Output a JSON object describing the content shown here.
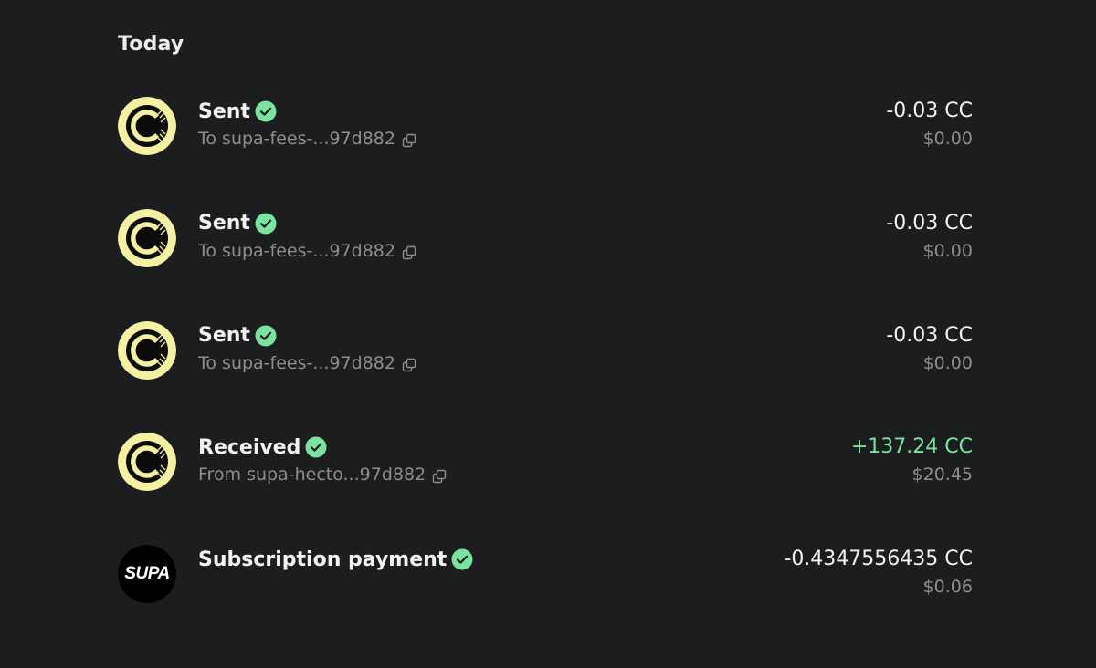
{
  "section": {
    "heading": "Today"
  },
  "colors": {
    "background": "#1c1d1f",
    "accent_green": "#7be3a0",
    "muted_text": "#8f8e8a",
    "coin_yellow": "#f4f1a3"
  },
  "transactions": [
    {
      "avatar": "canton-coin-icon",
      "title": "Sent",
      "status_icon": "verified-check-icon",
      "subtitle": "To supa-fees-...97d882",
      "copy_icon": "copy-icon",
      "amount": "-0.03 CC",
      "fiat": "$0.00",
      "positive": false
    },
    {
      "avatar": "canton-coin-icon",
      "title": "Sent",
      "status_icon": "verified-check-icon",
      "subtitle": "To supa-fees-...97d882",
      "copy_icon": "copy-icon",
      "amount": "-0.03 CC",
      "fiat": "$0.00",
      "positive": false
    },
    {
      "avatar": "canton-coin-icon",
      "title": "Sent",
      "status_icon": "verified-check-icon",
      "subtitle": "To supa-fees-...97d882",
      "copy_icon": "copy-icon",
      "amount": "-0.03 CC",
      "fiat": "$0.00",
      "positive": false
    },
    {
      "avatar": "canton-coin-icon",
      "title": "Received",
      "status_icon": "verified-check-icon",
      "subtitle": "From supa-hecto...97d882",
      "copy_icon": "copy-icon",
      "amount": "+137.24 CC",
      "fiat": "$20.45",
      "positive": true
    },
    {
      "avatar": "supa-logo-icon",
      "avatar_text": "SUPA",
      "title": "Subscription payment",
      "status_icon": "verified-check-icon",
      "subtitle": "",
      "amount": "-0.4347556435 CC",
      "fiat": "$0.06",
      "positive": false
    }
  ]
}
